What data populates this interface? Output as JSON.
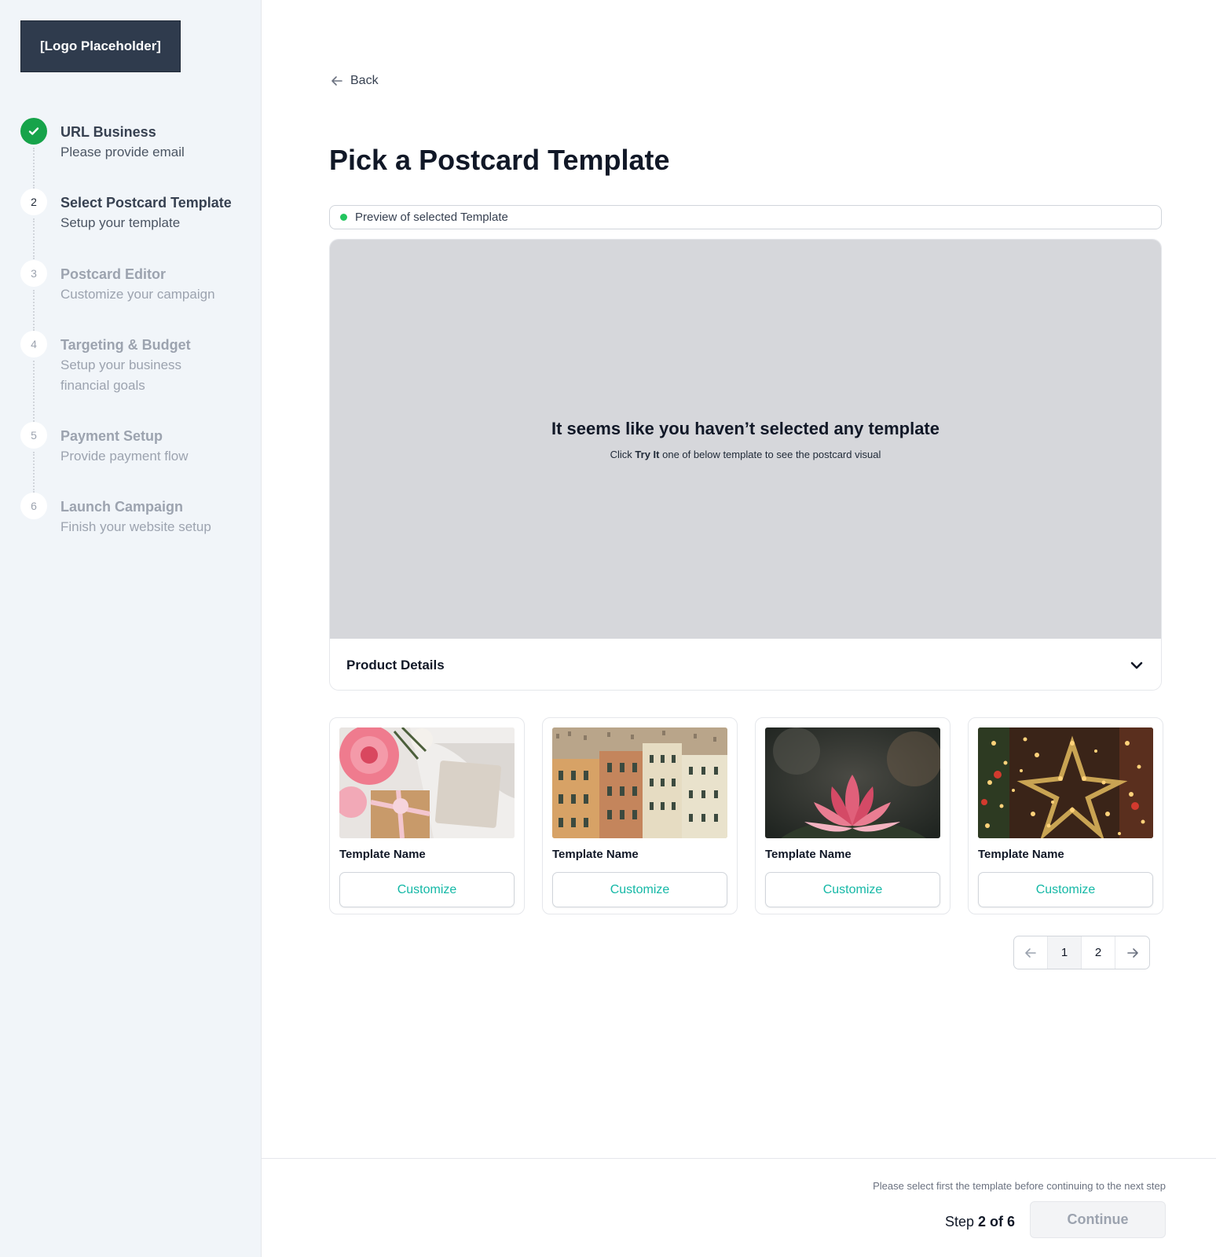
{
  "logo": {
    "text": "[Logo Placeholder]"
  },
  "steps": [
    {
      "number": "1",
      "title": "URL Business",
      "subtitle": "Please provide email",
      "status": "done"
    },
    {
      "number": "2",
      "title": "Select Postcard Template",
      "subtitle": "Setup your template",
      "status": "current"
    },
    {
      "number": "3",
      "title": "Postcard Editor",
      "subtitle": "Customize your campaign",
      "status": "upcoming"
    },
    {
      "number": "4",
      "title": "Targeting & Budget",
      "subtitle": "Setup your business financial goals",
      "status": "upcoming"
    },
    {
      "number": "5",
      "title": "Payment Setup",
      "subtitle": "Provide payment flow",
      "status": "upcoming"
    },
    {
      "number": "6",
      "title": "Launch Campaign",
      "subtitle": "Finish your website setup",
      "status": "upcoming"
    }
  ],
  "header": {
    "back_label": "Back",
    "title": "Pick a Postcard Template"
  },
  "preview": {
    "pill_label": "Preview of selected Template",
    "empty_title": "It seems like you haven’t selected any template",
    "empty_sub_prefix": "Click ",
    "empty_sub_bold": "Try It",
    "empty_sub_suffix": " one of below template to see the postcard visual",
    "details_label": "Product Details"
  },
  "templates": [
    {
      "name": "Template Name",
      "button": "Customize",
      "image": "flowers-gift-card"
    },
    {
      "name": "Template Name",
      "button": "Customize",
      "image": "city-buildings"
    },
    {
      "name": "Template Name",
      "button": "Customize",
      "image": "lotus-flower"
    },
    {
      "name": "Template Name",
      "button": "Customize",
      "image": "christmas-lights"
    }
  ],
  "pagination": {
    "pages": [
      "1",
      "2"
    ],
    "current": "1"
  },
  "footer": {
    "note": "Please select first the template before continuing to the next step",
    "step_prefix": "Step ",
    "step_value": "2 of 6",
    "continue_label": "Continue"
  },
  "colors": {
    "accent": "#14b8a6",
    "success": "#16a34a",
    "sidebar_bg": "#f1f5f9",
    "logo_bg": "#2f3b4d"
  }
}
